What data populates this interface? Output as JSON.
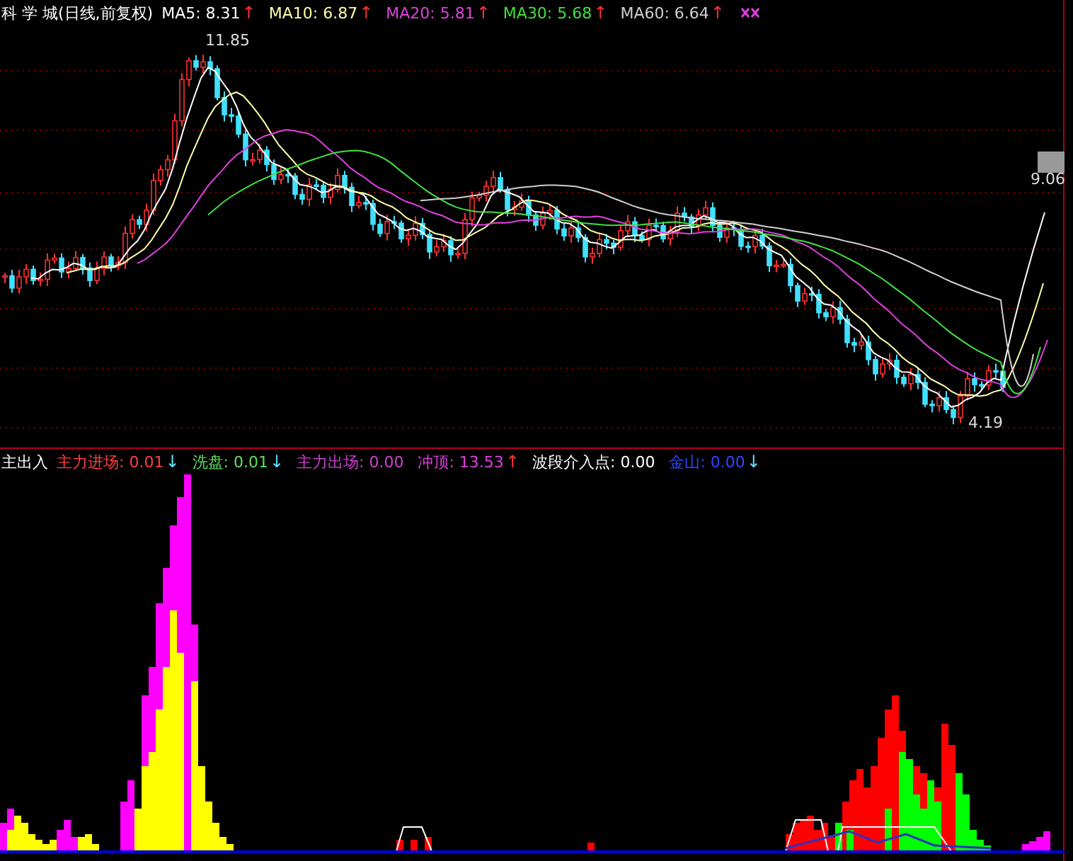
{
  "main_chart": {
    "title": "科 学 城(日线,前复权)",
    "indicators": [
      {
        "label": "MA5: 8.31",
        "arrow": {
          "text": "↑",
          "color": "#ff3030"
        },
        "color": "#ffffff"
      },
      {
        "label": "MA10: 6.87",
        "arrow": {
          "text": "↑",
          "color": "#ff3030"
        },
        "color": "#ffffaa"
      },
      {
        "label": "MA20: 5.81",
        "arrow": {
          "text": "↑",
          "color": "#ff3030"
        },
        "color": "#e040e0"
      },
      {
        "label": "MA30: 5.68",
        "arrow": {
          "text": "↑",
          "color": "#ff3030"
        },
        "color": "#40e040"
      },
      {
        "label": "MA60: 6.64",
        "arrow": {
          "text": "↑",
          "color": "#ff3030"
        },
        "color": "#d0d0d0"
      }
    ],
    "high_label": "11.85",
    "low_label": "4.19",
    "last_price": "9.06"
  },
  "sub_chart": {
    "title": "主出入",
    "indicators": [
      {
        "label": "主力进场: 0.01",
        "arrow": {
          "text": "↓",
          "color": "#60e0ff"
        },
        "color": "#ff4040"
      },
      {
        "label": "洗盘: 0.01",
        "arrow": {
          "text": "↓",
          "color": "#60e0ff"
        },
        "color": "#60e060"
      },
      {
        "label": "主力出场: 0.00",
        "color": "#d040d0"
      },
      {
        "label": "冲顶: 13.53",
        "arrow": {
          "text": "↑",
          "color": "#ff3030"
        },
        "color": "#e040e0"
      },
      {
        "label": "波段介入点: 0.00",
        "color": "#ffffff"
      },
      {
        "label": "金山: 0.00",
        "arrow": {
          "text": "↓",
          "color": "#60e0ff"
        },
        "color": "#3344ff"
      }
    ]
  }
}
